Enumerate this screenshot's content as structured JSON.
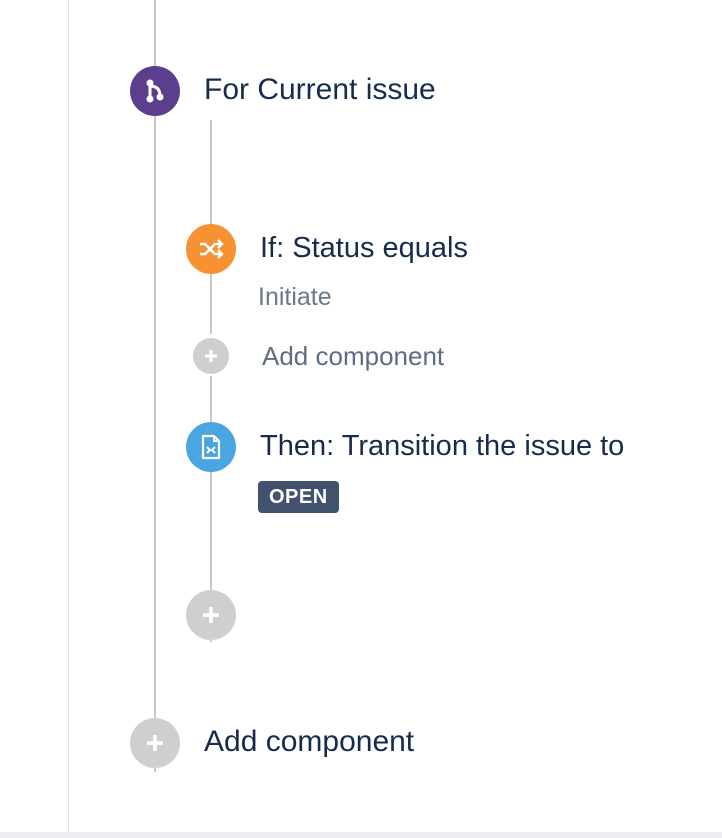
{
  "branch": {
    "title": "For Current issue",
    "icon": "branch-icon",
    "color": "#5b3f8c"
  },
  "condition": {
    "title": "If: Status equals",
    "value": "Initiate",
    "icon": "shuffle-icon",
    "color": "#f79232"
  },
  "inner_add": {
    "label": "Add component"
  },
  "action": {
    "title": "Then: Transition the issue to",
    "status_badge": "OPEN",
    "icon": "transition-icon",
    "color": "#4aa6e0"
  },
  "outer_add": {
    "label": "Add component"
  },
  "colors": {
    "connector": "#c8c8cc",
    "add_node": "#cfcfd1",
    "badge_bg": "#42526e"
  }
}
